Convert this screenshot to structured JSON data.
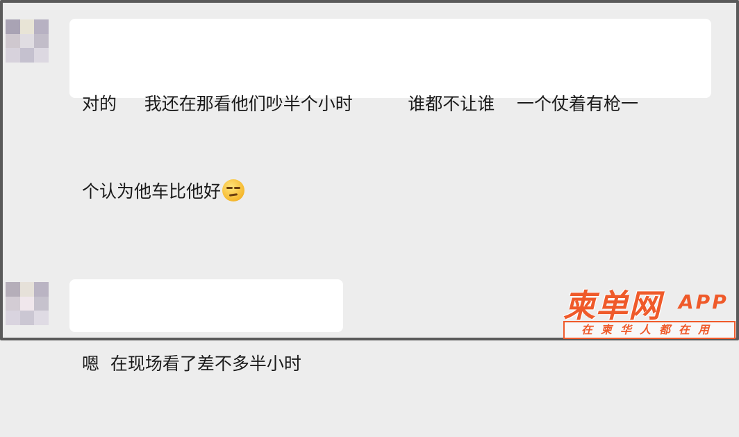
{
  "messages": [
    {
      "sender": "blurred-avatar",
      "line1": "对的     我还在那看他们吵半个小时          谁都不让谁    一个仗着有枪一",
      "line2": "个认为他车比他好",
      "emoji": "unamused-face-icon"
    },
    {
      "sender": "blurred-avatar",
      "line1": "嗯  在现场看了差不多半小时"
    }
  ],
  "watermark": {
    "brand": "柬单网",
    "suffix": "APP",
    "slogan": "在柬华人都在用",
    "color": "#ef5a2a"
  },
  "colors": {
    "background": "#ededed",
    "bubble": "#ffffff",
    "frame": "#5a5a5a"
  }
}
